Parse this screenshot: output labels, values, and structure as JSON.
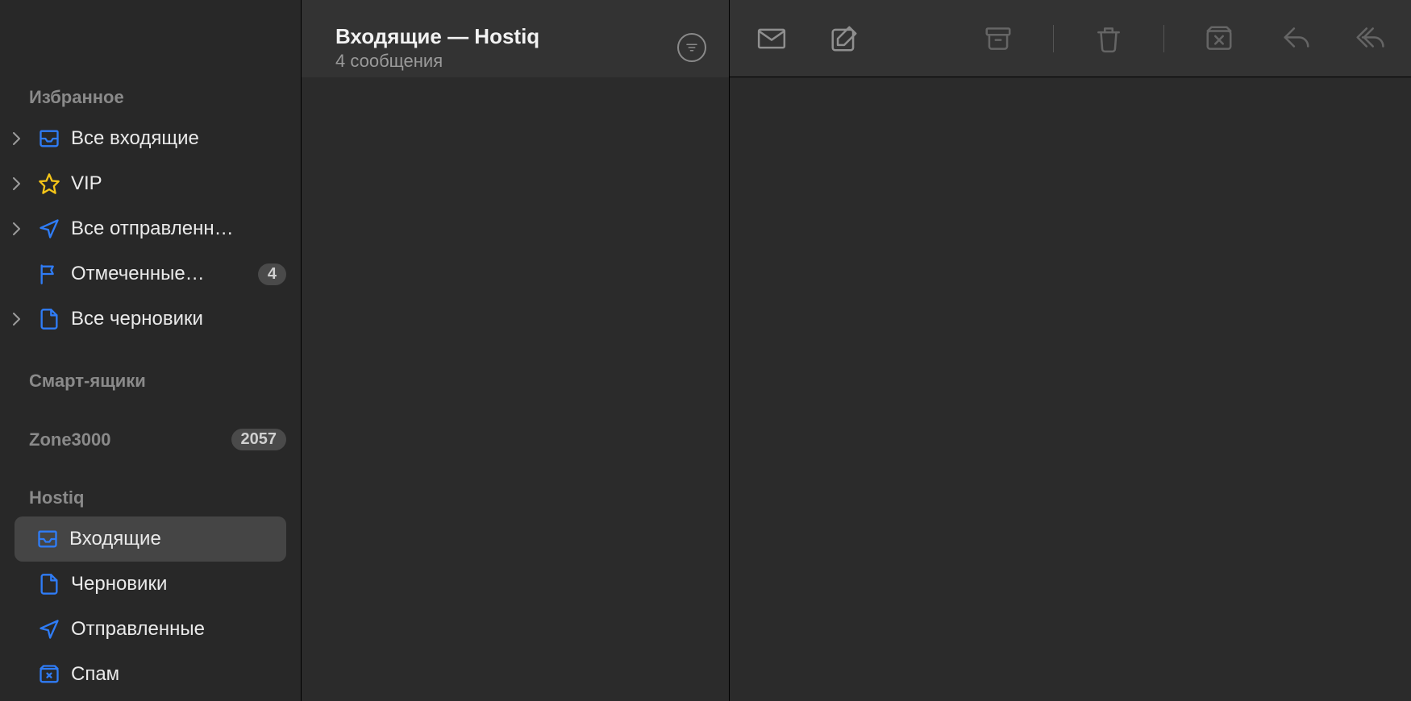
{
  "sidebar": {
    "sections": {
      "favorites": {
        "header": "Избранное",
        "items": [
          {
            "label": "Все входящие"
          },
          {
            "label": "VIP"
          },
          {
            "label": "Все отправленн…"
          },
          {
            "label": "Отмеченные…",
            "badge": "4"
          },
          {
            "label": "Все черновики"
          }
        ]
      },
      "smart": {
        "header": "Смарт-ящики"
      },
      "zone3000": {
        "header": "Zone3000",
        "badge": "2057"
      },
      "hostiq": {
        "header": "Hostiq",
        "items": [
          {
            "label": "Входящие"
          },
          {
            "label": "Черновики"
          },
          {
            "label": "Отправленные"
          },
          {
            "label": "Спам"
          }
        ]
      }
    }
  },
  "listPane": {
    "title": "Входящие — Hostiq",
    "subtitle": "4 сообщения"
  }
}
